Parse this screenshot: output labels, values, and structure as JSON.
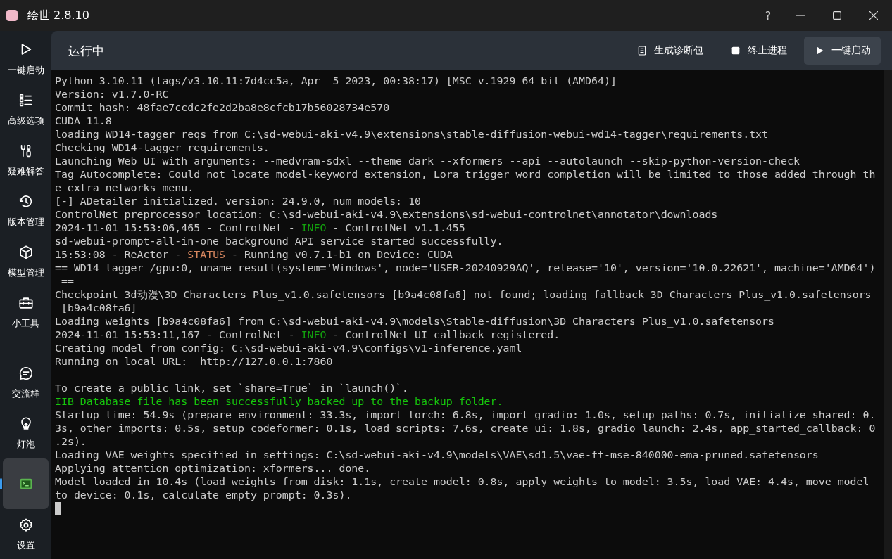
{
  "window": {
    "title": "绘世 2.8.10",
    "help_label": "?"
  },
  "sidebar": {
    "items": [
      {
        "label": "一键启动",
        "selected": false
      },
      {
        "label": "高级选项",
        "selected": false
      },
      {
        "label": "疑难解答",
        "selected": false
      },
      {
        "label": "版本管理",
        "selected": false
      },
      {
        "label": "模型管理",
        "selected": false
      },
      {
        "label": "小工具",
        "selected": false
      }
    ],
    "bottom_items": [
      {
        "label": "交流群",
        "selected": false
      },
      {
        "label": "灯泡",
        "selected": false
      },
      {
        "selected": true
      },
      {
        "label": "设置",
        "selected": false
      }
    ]
  },
  "header": {
    "title": "运行中",
    "buttons": [
      {
        "label": "生成诊断包",
        "primary": false
      },
      {
        "label": "终止进程",
        "primary": false
      },
      {
        "label": "一键启动",
        "primary": true
      }
    ]
  },
  "console": {
    "lines": [
      {
        "kind": "text",
        "segments": [
          {
            "text": "Python 3.10.11 (tags/v3.10.11:7d4cc5a, Apr  5 2023, 00:38:17) [MSC v.1929 64 bit (AMD64)]"
          }
        ]
      },
      {
        "kind": "text",
        "segments": [
          {
            "text": "Version: v1.7.0-RC"
          }
        ]
      },
      {
        "kind": "text",
        "segments": [
          {
            "text": "Commit hash: 48fae7ccdc2fe2d2ba8e8cfcb17b56028734e570"
          }
        ]
      },
      {
        "kind": "text",
        "segments": [
          {
            "text": "CUDA 11.8"
          }
        ]
      },
      {
        "kind": "text",
        "segments": [
          {
            "text": "loading WD14-tagger reqs from C:\\sd-webui-aki-v4.9\\extensions\\stable-diffusion-webui-wd14-tagger\\requirements.txt"
          }
        ]
      },
      {
        "kind": "text",
        "segments": [
          {
            "text": "Checking WD14-tagger requirements."
          }
        ]
      },
      {
        "kind": "text",
        "segments": [
          {
            "text": "Launching Web UI with arguments: --medvram-sdxl --theme dark --xformers --api --autolaunch --skip-python-version-check"
          }
        ]
      },
      {
        "kind": "text",
        "segments": [
          {
            "text": "Tag Autocomplete: Could not locate model-keyword extension, Lora trigger word completion will be limited to those added through th"
          }
        ]
      },
      {
        "kind": "text",
        "segments": [
          {
            "text": "e extra networks menu."
          }
        ]
      },
      {
        "kind": "text",
        "segments": [
          {
            "text": "[-] ADetailer initialized. version: 24.9.0, num models: 10"
          }
        ]
      },
      {
        "kind": "text",
        "segments": [
          {
            "text": "ControlNet preprocessor location: C:\\sd-webui-aki-v4.9\\extensions\\sd-webui-controlnet\\annotator\\downloads"
          }
        ]
      },
      {
        "kind": "text",
        "segments": [
          {
            "text": "2024-11-01 15:53:06,465 - ControlNet - "
          },
          {
            "text": "INFO",
            "color": "#13a10e"
          },
          {
            "text": " - ControlNet v1.1.455"
          }
        ]
      },
      {
        "kind": "text",
        "segments": [
          {
            "text": "sd-webui-prompt-all-in-one background API service started successfully."
          }
        ]
      },
      {
        "kind": "text",
        "segments": [
          {
            "text": "15:53:08 - ReActor - "
          },
          {
            "text": "STATUS",
            "color": "#d7875f"
          },
          {
            "text": " - Running v0.7.1-b1 on Device: CUDA"
          }
        ]
      },
      {
        "kind": "text",
        "segments": [
          {
            "text": "== WD14 tagger /gpu:0, uname_result(system='Windows', node='USER-20240929AQ', release='10', version='10.0.22621', machine='AMD64')"
          }
        ]
      },
      {
        "kind": "text",
        "segments": [
          {
            "text": " =="
          }
        ]
      },
      {
        "kind": "text",
        "segments": [
          {
            "text": "Checkpoint 3d动漫\\3D Characters Plus_v1.0.safetensors [b9a4c08fa6] not found; loading fallback 3D Characters Plus_v1.0.safetensors"
          }
        ]
      },
      {
        "kind": "text",
        "segments": [
          {
            "text": " [b9a4c08fa6]"
          }
        ]
      },
      {
        "kind": "text",
        "segments": [
          {
            "text": "Loading weights [b9a4c08fa6] from C:\\sd-webui-aki-v4.9\\models\\Stable-diffusion\\3D Characters Plus_v1.0.safetensors"
          }
        ]
      },
      {
        "kind": "text",
        "segments": [
          {
            "text": "2024-11-01 15:53:11,167 - ControlNet - "
          },
          {
            "text": "INFO",
            "color": "#13a10e"
          },
          {
            "text": " - ControlNet UI callback registered."
          }
        ]
      },
      {
        "kind": "text",
        "segments": [
          {
            "text": "Creating model from config: C:\\sd-webui-aki-v4.9\\configs\\v1-inference.yaml"
          }
        ]
      },
      {
        "kind": "text",
        "segments": [
          {
            "text": "Running on local URL:  http://127.0.0.1:7860"
          }
        ]
      },
      {
        "kind": "blank"
      },
      {
        "kind": "text",
        "segments": [
          {
            "text": "To create a public link, set `share=True` in `launch()`."
          }
        ]
      },
      {
        "kind": "text",
        "segments": [
          {
            "text": "IIB Database file has been successfully backed up to the backup folder.",
            "color": "#16c60c"
          }
        ]
      },
      {
        "kind": "text",
        "segments": [
          {
            "text": "Startup time: 54.9s (prepare environment: 33.3s, import torch: 6.8s, import gradio: 1.0s, setup paths: 0.7s, initialize shared: 0."
          }
        ]
      },
      {
        "kind": "text",
        "segments": [
          {
            "text": "3s, other imports: 0.5s, setup codeformer: 0.1s, load scripts: 7.6s, create ui: 1.8s, gradio launch: 2.4s, app_started_callback: 0"
          }
        ]
      },
      {
        "kind": "text",
        "segments": [
          {
            "text": ".2s)."
          }
        ]
      },
      {
        "kind": "text",
        "segments": [
          {
            "text": "Loading VAE weights specified in settings: C:\\sd-webui-aki-v4.9\\models\\VAE\\sd1.5\\vae-ft-mse-840000-ema-pruned.safetensors"
          }
        ]
      },
      {
        "kind": "text",
        "segments": [
          {
            "text": "Applying attention optimization: xformers... done."
          }
        ]
      },
      {
        "kind": "text",
        "segments": [
          {
            "text": "Model loaded in 10.4s (load weights from disk: 1.1s, create model: 0.8s, apply weights to model: 3.5s, load VAE: 4.4s, move model"
          }
        ]
      },
      {
        "kind": "text",
        "segments": [
          {
            "text": "to device: 0.1s, calculate empty prompt: 0.3s)."
          }
        ]
      },
      {
        "kind": "cursor"
      }
    ]
  }
}
